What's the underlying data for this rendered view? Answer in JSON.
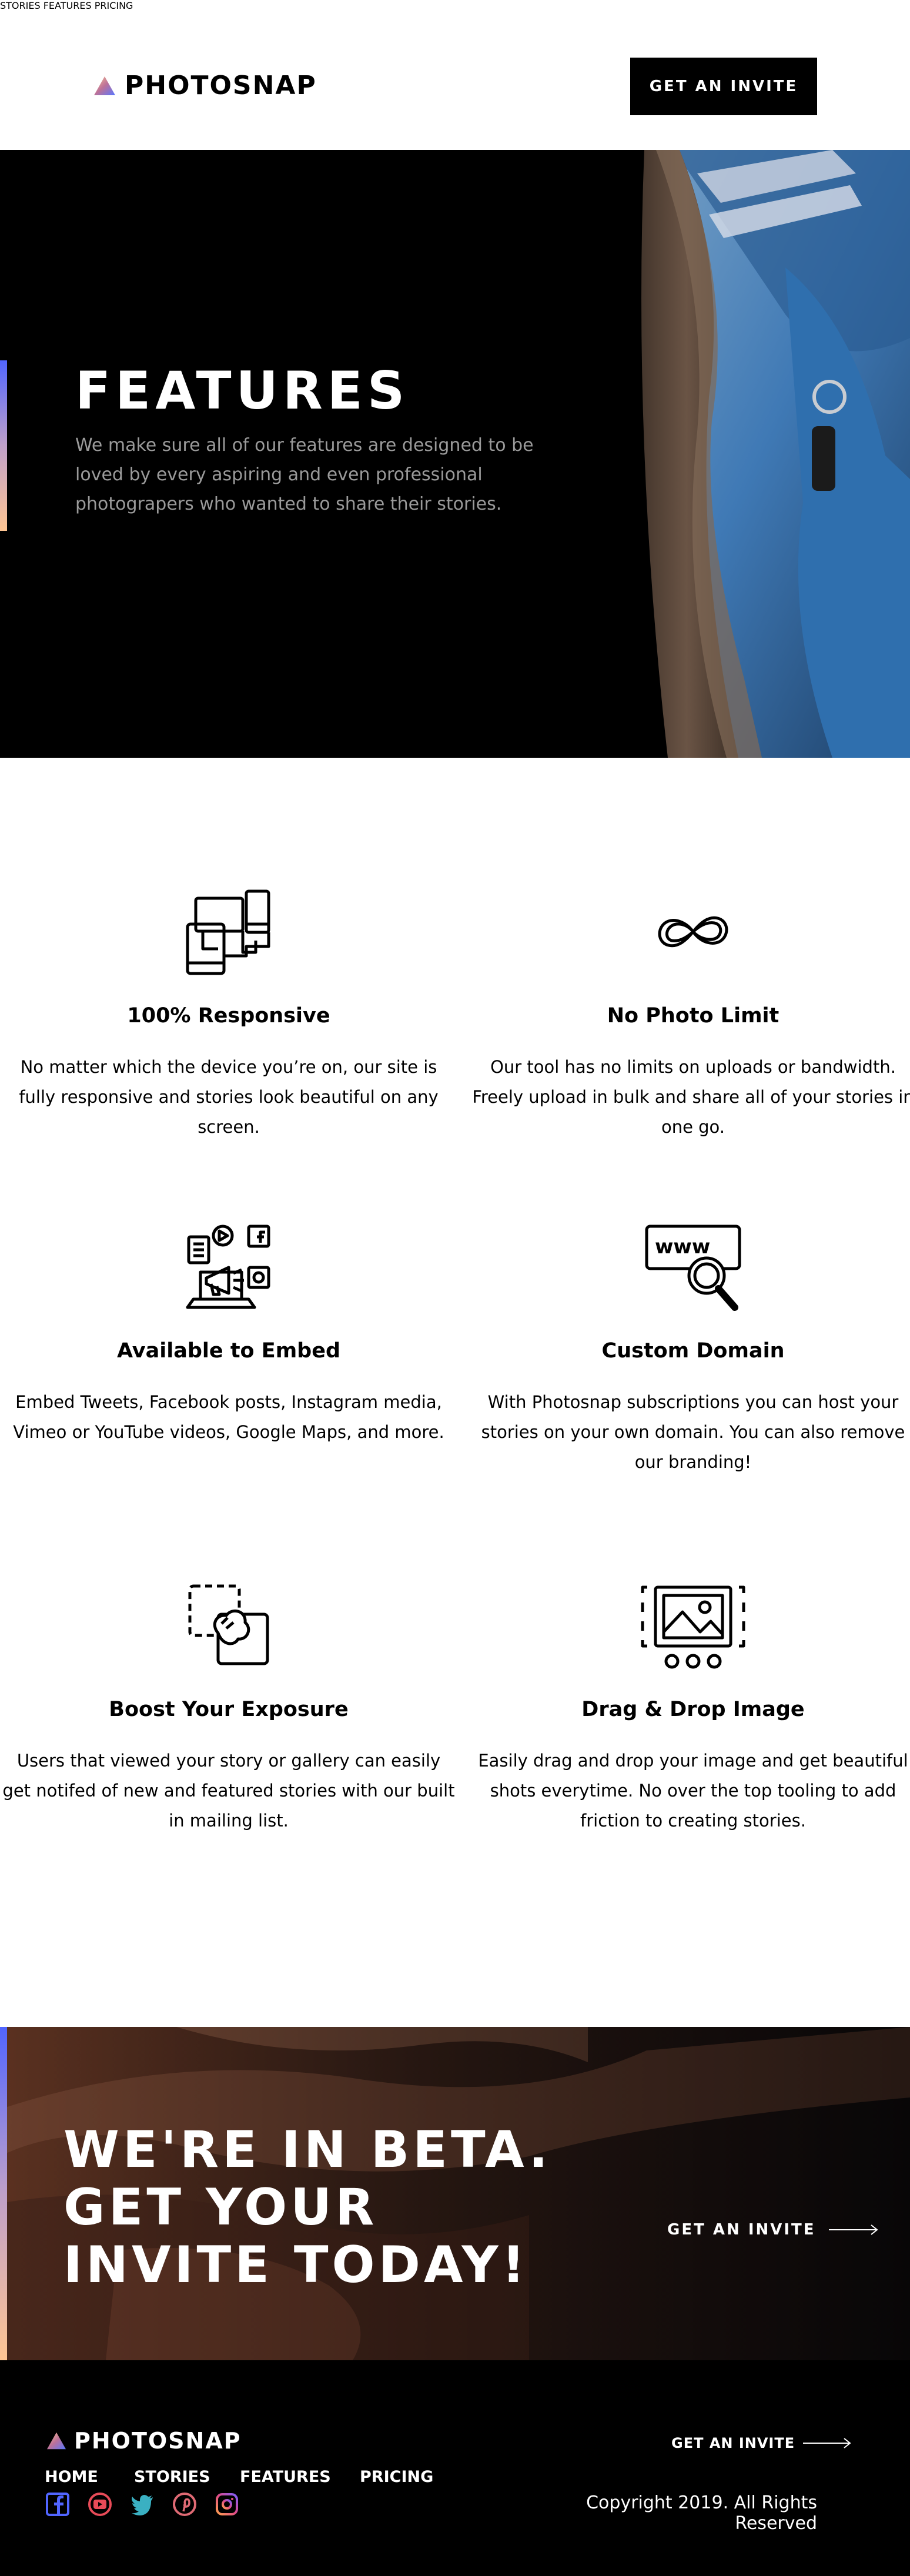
{
  "header": {
    "logo_text": "PHOTOSNAP",
    "nav": [
      "STORIES",
      "FEATURES",
      "PRICING"
    ],
    "cta_label": "GET AN INVITE"
  },
  "hero": {
    "title": "FEATURES",
    "text": "We make sure all of our features are designed to be loved by every aspiring and even professional photograpers who wanted to share their stories."
  },
  "features": [
    {
      "icon": "responsive-devices-icon",
      "title": "100% Responsive",
      "text": "No matter which the device you’re on, our site is fully responsive and stories look beautiful on any screen."
    },
    {
      "icon": "infinity-icon",
      "title": "No Photo Limit",
      "text": "Our tool has no limits on uploads or bandwidth. Freely upload in bulk and share all of your stories in one go."
    },
    {
      "icon": "embed-media-icon",
      "title": "Available to Embed",
      "text": "Embed Tweets, Facebook posts, Instagram media, Vimeo or YouTube videos, Google Maps, and more."
    },
    {
      "icon": "custom-domain-icon",
      "title": "Custom Domain",
      "text": "With Photosnap subscriptions you can host your stories on your own domain. You can also remove our branding!"
    },
    {
      "icon": "boost-exposure-icon",
      "title": "Boost Your Exposure",
      "text": "Users that viewed your story or gallery can easily get notifed of new and featured stories with our built in mailing list."
    },
    {
      "icon": "drag-drop-image-icon",
      "title": "Drag & Drop Image",
      "text": "Easily drag and drop your image and get beautiful shots everytime. No over the top tooling to add friction to creating stories."
    }
  ],
  "beta": {
    "title": "WE'RE IN BETA. GET YOUR INVITE TODAY!",
    "link_label": "GET AN INVITE"
  },
  "footer": {
    "logo_text": "PHOTOSNAP",
    "nav": [
      "HOME",
      "STORIES",
      "FEATURES",
      "PRICING"
    ],
    "social": [
      "facebook-icon",
      "youtube-icon",
      "twitter-icon",
      "pinterest-icon",
      "instagram-icon"
    ],
    "invite_label": "GET AN INVITE",
    "copyright": "Copyright 2019. All Rights Reserved"
  },
  "colors": {
    "gradient_start": "#5165ff",
    "gradient_mid": "#bfa0c9",
    "gradient_end": "#ffc593"
  }
}
